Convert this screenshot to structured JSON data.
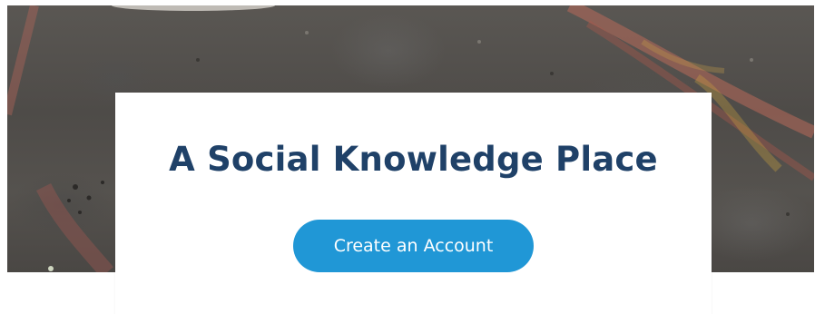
{
  "hero": {
    "headline": "A Social Knowledge Place",
    "cta_label": "Create an Account"
  },
  "colors": {
    "headline": "#1f4168",
    "cta_background": "#2097d6",
    "cta_text": "#ffffff",
    "card_background": "#ffffff"
  }
}
